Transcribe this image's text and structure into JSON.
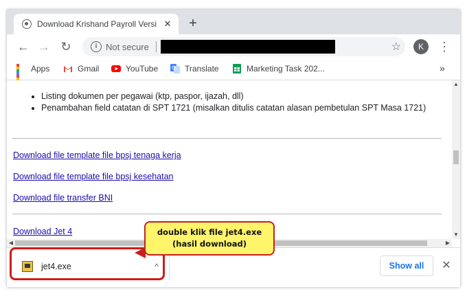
{
  "tab": {
    "title": "Download Krishand Payroll Versi",
    "close": "✕",
    "new_tab": "+"
  },
  "toolbar": {
    "back": "←",
    "forward": "→",
    "reload": "↻",
    "security_label": "Not secure",
    "star": "☆",
    "avatar": "K",
    "menu": "⋮"
  },
  "bookmarks": {
    "items": [
      {
        "label": "Apps",
        "icon": "apps-grid-icon"
      },
      {
        "label": "Gmail",
        "icon": "gmail-icon"
      },
      {
        "label": "YouTube",
        "icon": "youtube-icon"
      },
      {
        "label": "Translate",
        "icon": "translate-icon"
      },
      {
        "label": "Marketing Task 202...",
        "icon": "sheets-icon"
      }
    ],
    "overflow": "»"
  },
  "content": {
    "bullets": [
      "Listing dokumen per pegawai (ktp, paspor, ijazah, dll)",
      "Penambahan field catatan di SPT 1721 (misalkan ditulis catatan alasan pembetulan SPT Masa 1721)"
    ],
    "links": [
      "Download file template file bpsj tenaga kerja",
      "Download file template file bpsj kesehatan",
      "Download file transfer BNI",
      "Download Jet 4"
    ]
  },
  "download_shelf": {
    "filename": "jet4.exe",
    "chevron": "^",
    "show_all": "Show all",
    "close": "✕"
  },
  "callout": {
    "line1": "double klik file jet4.exe",
    "line2": "(hasil download)"
  },
  "colors": {
    "accent": "#1a73e8",
    "link": "#1a0dab",
    "callout_bg": "#fff46a",
    "annotation_red": "#d11a1a"
  }
}
